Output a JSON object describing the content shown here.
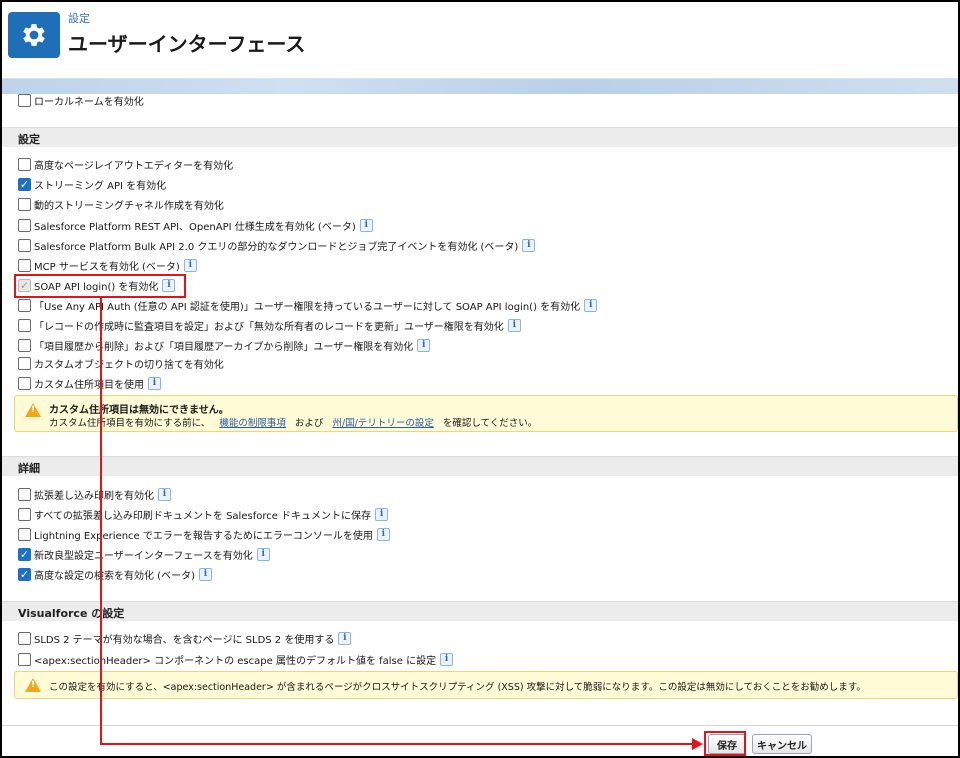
{
  "header": {
    "category": "設定",
    "title": "ユーザーインターフェース",
    "icon": "gear-icon"
  },
  "top_item": {
    "label": "ローカルネームを有効化",
    "checked": false
  },
  "section_settings": {
    "title": "設定",
    "items": [
      {
        "label": "高度なページレイアウトエディターを有効化",
        "checked": false,
        "info": false
      },
      {
        "label": "ストリーミング API を有効化",
        "checked": true,
        "info": false
      },
      {
        "label": "動的ストリーミングチャネル作成を有効化",
        "checked": false,
        "info": false
      },
      {
        "label": "Salesforce Platform REST API、OpenAPI 仕様生成を有効化 (ベータ)",
        "checked": false,
        "info": true
      },
      {
        "label": "Salesforce Platform Bulk API 2.0 クエリの部分的なダウンロードとジョブ完了イベントを有効化 (ベータ)",
        "checked": false,
        "info": true
      },
      {
        "label": "MCP サービスを有効化 (ベータ)",
        "checked": false,
        "info": true
      },
      {
        "label": "SOAP API login() を有効化",
        "checked": true,
        "disabled": true,
        "info": true
      },
      {
        "label": "「Use Any API Auth (任意の API 認証を使用)」ユーザー権限を持っているユーザーに対して SOAP API login() を有効化",
        "checked": false,
        "info": true
      },
      {
        "label": "「レコードの作成時に監査項目を設定」および「無効な所有者のレコードを更新」ユーザー権限を有効化",
        "checked": false,
        "info": true
      },
      {
        "label": "「項目履歴から削除」および「項目履歴アーカイブから削除」ユーザー権限を有効化",
        "checked": false,
        "info": true
      },
      {
        "label": "カスタムオブジェクトの切り捨てを有効化",
        "checked": false,
        "info": false
      },
      {
        "label": "カスタム住所項目を使用",
        "checked": false,
        "info": true
      }
    ],
    "warning": {
      "title": "カスタム住所項目は無効にできません。",
      "text_before": "カスタム住所項目を有効にする前に、",
      "link1": "機能の制限事項",
      "text_mid": "および",
      "link2": "州/国/テリトリーの設定",
      "text_after": "を確認してください。"
    }
  },
  "section_details": {
    "title": "詳細",
    "items": [
      {
        "label": "拡張差し込み印刷を有効化",
        "checked": false,
        "info": true
      },
      {
        "label": "すべての拡張差し込み印刷ドキュメントを Salesforce ドキュメントに保存",
        "checked": false,
        "info": true
      },
      {
        "label": "Lightning Experience でエラーを報告するためにエラーコンソールを使用",
        "checked": false,
        "info": true
      },
      {
        "label": "新改良型設定ユーザーインターフェースを有効化",
        "checked": true,
        "info": true
      },
      {
        "label": "高度な設定の検索を有効化 (ベータ)",
        "checked": true,
        "info": true
      }
    ]
  },
  "section_vf": {
    "title": "Visualforce の設定",
    "items": [
      {
        "label": "SLDS 2 テーマが有効な場合、を含むページに SLDS 2 を使用する",
        "checked": false,
        "info": true
      },
      {
        "label": "<apex:sectionHeader> コンポーネントの escape 属性のデフォルト値を false に設定",
        "checked": false,
        "info": true
      }
    ],
    "warning": "この設定を有効にすると、<apex:sectionHeader> が含まれるページがクロスサイトスクリプティング (XSS) 攻撃に対して脆弱になります。この設定は無効にしておくことをお勧めします。"
  },
  "buttons": {
    "save": "保存",
    "cancel": "キャンセル"
  },
  "colors": {
    "accent": "#1b70c7",
    "highlight": "#e4121b",
    "warning_bg": "#fffbd6"
  }
}
